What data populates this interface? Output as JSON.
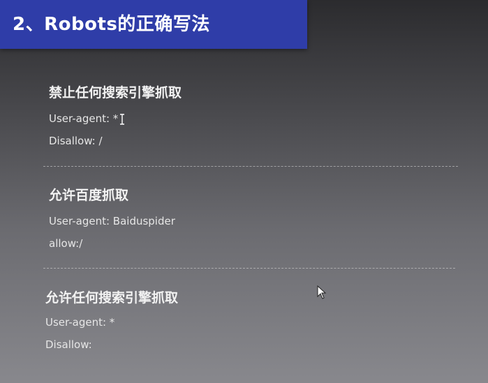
{
  "slide": {
    "title": "2、Robots的正确写法"
  },
  "sections": [
    {
      "heading": "禁止任何搜索引擎抓取",
      "lines": [
        "User-agent: *",
        "Disallow: /"
      ]
    },
    {
      "heading": "允许百度抓取",
      "lines": [
        "User-agent: Baiduspider",
        "allow:/"
      ]
    },
    {
      "heading": "允许任何搜索引擎抓取",
      "lines": [
        "User-agent: *",
        "Disallow:"
      ]
    }
  ],
  "colors": {
    "title_bar": "#2f3da8",
    "text": "#ffffff"
  },
  "icons": {
    "text_cursor": "ibeam-cursor-icon",
    "mouse_pointer": "mouse-pointer-icon"
  }
}
